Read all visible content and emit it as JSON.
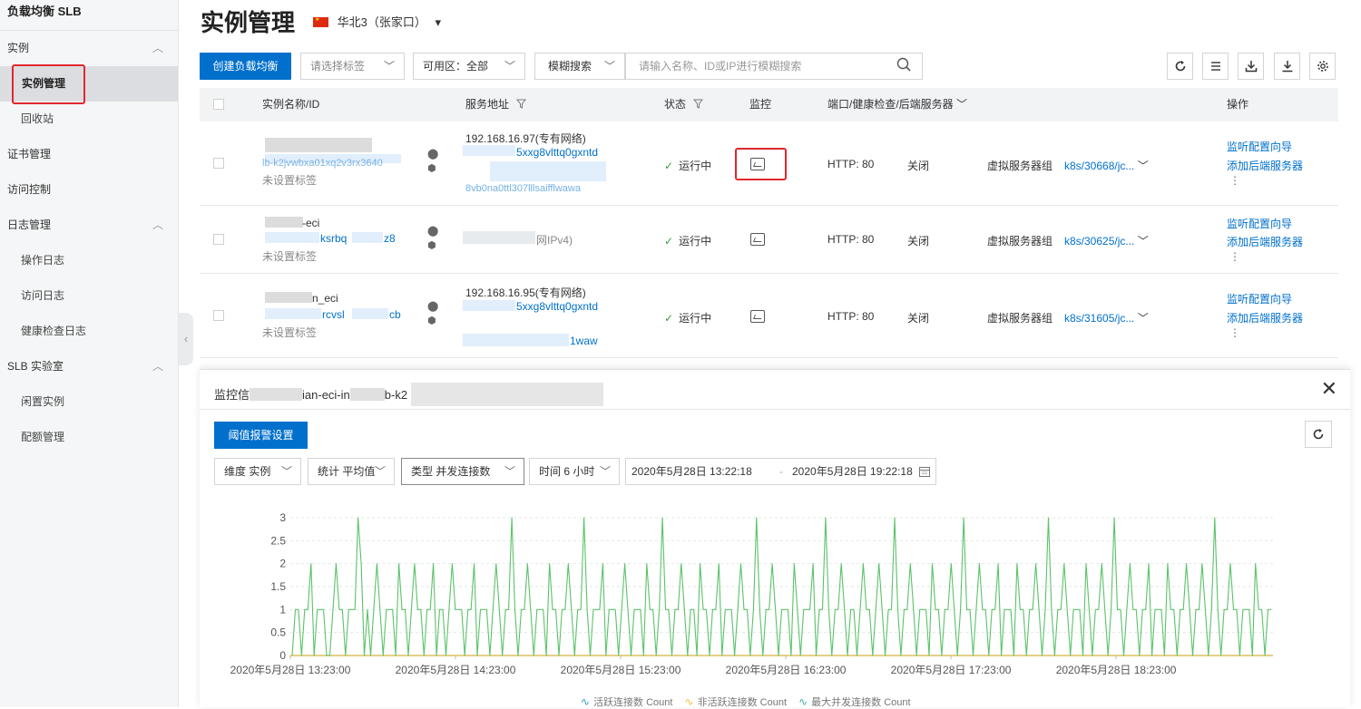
{
  "sidebar": {
    "title": "负载均衡 SLB",
    "groups": [
      {
        "label": "实例",
        "items": [
          "实例管理",
          "回收站"
        ]
      },
      {
        "label": "证书管理"
      },
      {
        "label": "访问控制"
      },
      {
        "label": "日志管理",
        "items": [
          "操作日志",
          "访问日志",
          "健康检查日志"
        ]
      },
      {
        "label": "SLB 实验室",
        "items": [
          "闲置实例",
          "配额管理"
        ]
      }
    ],
    "collapse_glyph": "‹",
    "expand_glyph": "︿"
  },
  "header": {
    "title": "实例管理",
    "region": "华北3（张家口）",
    "region_caret": "▾"
  },
  "toolbar": {
    "create_label": "创建负载均衡",
    "tag_placeholder": "请选择标签",
    "zone_label": "可用区：全部",
    "search_mode": "模糊搜索",
    "search_placeholder": "请输入名称、ID或IP进行模糊搜索",
    "caret": "﹀"
  },
  "table": {
    "headers": {
      "name": "实例名称/ID",
      "address": "服务地址",
      "status": "状态",
      "monitor": "监控",
      "port": "端口/健康检查/后端服务器",
      "ops": "操作"
    },
    "rows": [
      {
        "name_line1": "",
        "id_fragment": "lb-k2jvwbxa01xq2v3rx3640",
        "tag": "未设置标签",
        "addr_line1": "192.168.16.97(专有网络)",
        "addr_line2": "5xxg8vlttq0gxntd",
        "addr_line3": "8vb0na0ttl307lllsaifflwawa",
        "status": "运行中",
        "port": "HTTP: 80",
        "health": "关闭",
        "backend_type": "虚拟服务器组",
        "backend": "k8s/30668/jc...",
        "op1": "监听配置向导",
        "op2": "添加后端服务器",
        "more": "⋮"
      },
      {
        "name_line1": "-eci",
        "id_fragment": "ksrbq",
        "id_tail": "z8",
        "tag": "未设置标签",
        "addr_line1": "网IPv4)",
        "status": "运行中",
        "port": "HTTP: 80",
        "health": "关闭",
        "backend_type": "虚拟服务器组",
        "backend": "k8s/30625/jc...",
        "op1": "监听配置向导",
        "op2": "添加后端服务器",
        "more": "⋮"
      },
      {
        "name_line1": "n_eci",
        "id_fragment": "rcvsl",
        "id_tail": "cb",
        "tag": "未设置标签",
        "addr_line1": "192.168.16.95(专有网络)",
        "addr_line2": "5xxg8vlttq0gxntd",
        "addr_line3": "1waw",
        "status": "运行中",
        "port": "HTTP: 80",
        "health": "关闭",
        "backend_type": "虚拟服务器组",
        "backend": "k8s/31605/jc...",
        "op1": "监听配置向导",
        "op2": "添加后端服务器",
        "more": "⋮"
      }
    ]
  },
  "monitor_panel": {
    "title_prefix": "监控信",
    "title_mid": "ian-eci-in",
    "title_tail": "b-k2",
    "alarm_button": "阈值报警设置",
    "dimension": "维度 实例",
    "statistic": "统计 平均值",
    "type": "类型 并发连接数",
    "time": "时间 6 小时",
    "start": "2020年5月28日 13:22:18",
    "end": "2020年5月28日 19:22:18",
    "range_sep": "-",
    "legend": [
      {
        "name": "活跃连接数 Count",
        "color": "#2f9bd6"
      },
      {
        "name": "非活跃连接数 Count",
        "color": "#f5c242"
      },
      {
        "name": "最大并发连接数 Count",
        "color": "#3fb0a0"
      }
    ]
  },
  "chart_data": {
    "type": "line",
    "title": "",
    "xlabel": "",
    "ylabel": "",
    "ylim": [
      0,
      3
    ],
    "yticks": [
      "0",
      "0.5",
      "1",
      "1.5",
      "2",
      "2.5",
      "3"
    ],
    "xticks": [
      "2020年5月28日 13:23:00",
      "2020年5月28日 14:23:00",
      "2020年5月28日 15:23:00",
      "2020年5月28日 16:23:00",
      "2020年5月28日 17:23:00",
      "2020年5月28日 18:23:00"
    ],
    "grid": true,
    "series": [
      {
        "name": "活跃连接数 Count",
        "color": "#2f9bd6",
        "values": "constant-zero"
      },
      {
        "name": "非活跃连接数 Count",
        "color": "#f5c242",
        "values": "constant-zero"
      },
      {
        "name": "最大并发连接数 Count",
        "color": "#5bc26a",
        "values": [
          0,
          1,
          1,
          0,
          1,
          1,
          2,
          0,
          1,
          1,
          1,
          0,
          0,
          1,
          2,
          1,
          1,
          0,
          1,
          1,
          1,
          3,
          2,
          0,
          1,
          0,
          1,
          2,
          1,
          0,
          1,
          1,
          1,
          0,
          2,
          1,
          1,
          0,
          1,
          2,
          1,
          1,
          0,
          1,
          1,
          2,
          0,
          1,
          1,
          0,
          1,
          2,
          1,
          1,
          1,
          0,
          1,
          1,
          2,
          0,
          1,
          1,
          1,
          0,
          1,
          2,
          1,
          0,
          1,
          1,
          3,
          1,
          0,
          1,
          1,
          2,
          1,
          0,
          1,
          1,
          1,
          0,
          2,
          1,
          1,
          0,
          1,
          1,
          2,
          1,
          0,
          1,
          1,
          3,
          1,
          0,
          1,
          1,
          1,
          2,
          0,
          1,
          1,
          1,
          0,
          1,
          2,
          1,
          0,
          1,
          1,
          1,
          0,
          2,
          1,
          1,
          0,
          1,
          3,
          1,
          1,
          0,
          1,
          1,
          2,
          1,
          0,
          1,
          1,
          0,
          2,
          1,
          1,
          0,
          1,
          1,
          2,
          0,
          1,
          1,
          1,
          0,
          1,
          2,
          1,
          1,
          0,
          1,
          3,
          1,
          0,
          1,
          1,
          2,
          1,
          0,
          1,
          1,
          1,
          0,
          2,
          1,
          0,
          1,
          1,
          1,
          2,
          0,
          1,
          1,
          3,
          1,
          0,
          1,
          1,
          2,
          1,
          0,
          1,
          1,
          0,
          1,
          2,
          1,
          1,
          0,
          1,
          2,
          1,
          0,
          1,
          1,
          3,
          1,
          0,
          1,
          1,
          2,
          1,
          0,
          1,
          1,
          1,
          0,
          2,
          1,
          1,
          0,
          1,
          1,
          2,
          1,
          0,
          1,
          3,
          1,
          1,
          0,
          1,
          2,
          1,
          1,
          0,
          1,
          1,
          2,
          0,
          1,
          1,
          1,
          0,
          2,
          1,
          1,
          0,
          1,
          1,
          2,
          1,
          0,
          1,
          3,
          1,
          0,
          1,
          1,
          2,
          1,
          0,
          1,
          1,
          1,
          0,
          2,
          1,
          0,
          1,
          1,
          2,
          1,
          0,
          1,
          3,
          1,
          1,
          0,
          1,
          2,
          1,
          1,
          0,
          1,
          1,
          2,
          0,
          1,
          1,
          1,
          0,
          2,
          1,
          1,
          0,
          1,
          1,
          2,
          1,
          0,
          1,
          1,
          2,
          1,
          0,
          1,
          3,
          1,
          0,
          1,
          1,
          2,
          1,
          1,
          0,
          1,
          1,
          1,
          0,
          2,
          1,
          1,
          0,
          1,
          1
        ]
      }
    ]
  }
}
